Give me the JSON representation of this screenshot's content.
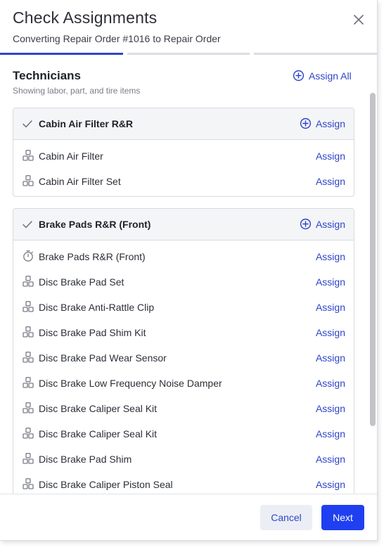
{
  "dialog": {
    "title": "Check Assignments",
    "subtitle": "Converting Repair Order #1016 to Repair Order",
    "steps": 3,
    "active_step": 1
  },
  "section": {
    "title": "Technicians",
    "subtitle": "Showing labor, part, and tire items",
    "assign_all_label": "Assign All"
  },
  "cards": [
    {
      "name": "Cabin Air Filter R&R",
      "assign_label": "Assign",
      "items": [
        {
          "icon": "part-icon",
          "name": "Cabin Air Filter",
          "assign_label": "Assign"
        },
        {
          "icon": "part-icon",
          "name": "Cabin Air Filter Set",
          "assign_label": "Assign"
        }
      ]
    },
    {
      "name": "Brake Pads R&R (Front)",
      "assign_label": "Assign",
      "items": [
        {
          "icon": "labor-timer-icon",
          "name": "Brake Pads R&R (Front)",
          "assign_label": "Assign"
        },
        {
          "icon": "part-icon",
          "name": "Disc Brake Pad Set",
          "assign_label": "Assign"
        },
        {
          "icon": "part-icon",
          "name": "Disc Brake Anti-Rattle Clip",
          "assign_label": "Assign"
        },
        {
          "icon": "part-icon",
          "name": "Disc Brake Pad Shim Kit",
          "assign_label": "Assign"
        },
        {
          "icon": "part-icon",
          "name": "Disc Brake Pad Wear Sensor",
          "assign_label": "Assign"
        },
        {
          "icon": "part-icon",
          "name": "Disc Brake Low Frequency Noise Damper",
          "assign_label": "Assign"
        },
        {
          "icon": "part-icon",
          "name": "Disc Brake Caliper Seal Kit",
          "assign_label": "Assign"
        },
        {
          "icon": "part-icon",
          "name": "Disc Brake Caliper Seal Kit",
          "assign_label": "Assign"
        },
        {
          "icon": "part-icon",
          "name": "Disc Brake Pad Shim",
          "assign_label": "Assign"
        },
        {
          "icon": "part-icon",
          "name": "Disc Brake Caliper Piston Seal",
          "assign_label": "Assign"
        }
      ]
    }
  ],
  "footer": {
    "cancel_label": "Cancel",
    "next_label": "Next"
  },
  "colors": {
    "accent": "#2f45c9",
    "primary_button": "#1f3ff0",
    "secondary_button_bg": "#eceef5"
  }
}
